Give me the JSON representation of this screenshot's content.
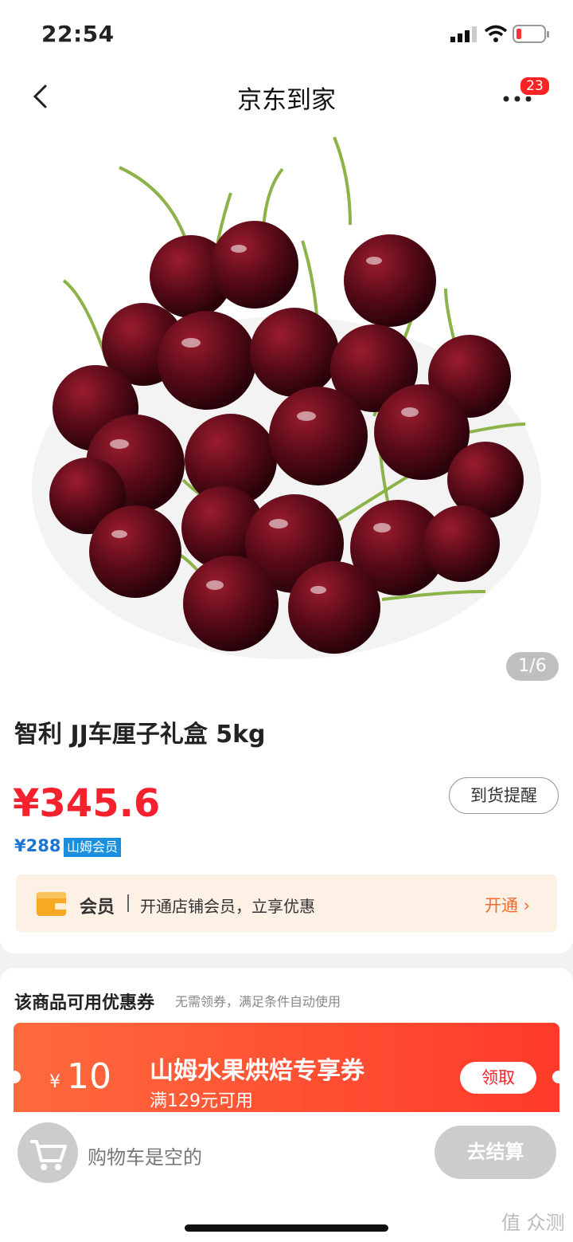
{
  "status": {
    "time": "22:54"
  },
  "nav": {
    "title": "京东到家",
    "badge": "23"
  },
  "gallery": {
    "counter": "1/6"
  },
  "product": {
    "title": "智利 JJ车厘子礼盒 5kg",
    "price": "¥345.6",
    "remind_label": "到货提醒",
    "member_price": "¥288",
    "member_tag": "山姆会员"
  },
  "membership": {
    "label": "会员",
    "text": "开通店铺会员，立享优惠",
    "action": "开通 ›"
  },
  "coupons": {
    "heading": "该商品可用优惠券",
    "subheading": "无需领券，满足条件自动使用",
    "items": [
      {
        "currency": "¥",
        "amount": "10",
        "name": "山姆水果烘焙专享券",
        "condition": "满129元可用",
        "action": "领取"
      }
    ]
  },
  "cart": {
    "empty_text": "购物车是空的",
    "checkout_label": "去结算"
  },
  "watermark": "值 众测",
  "colors": {
    "price_red": "#f5222d",
    "member_blue": "#1a73d6",
    "coupon_orange": "#ff5a33"
  }
}
